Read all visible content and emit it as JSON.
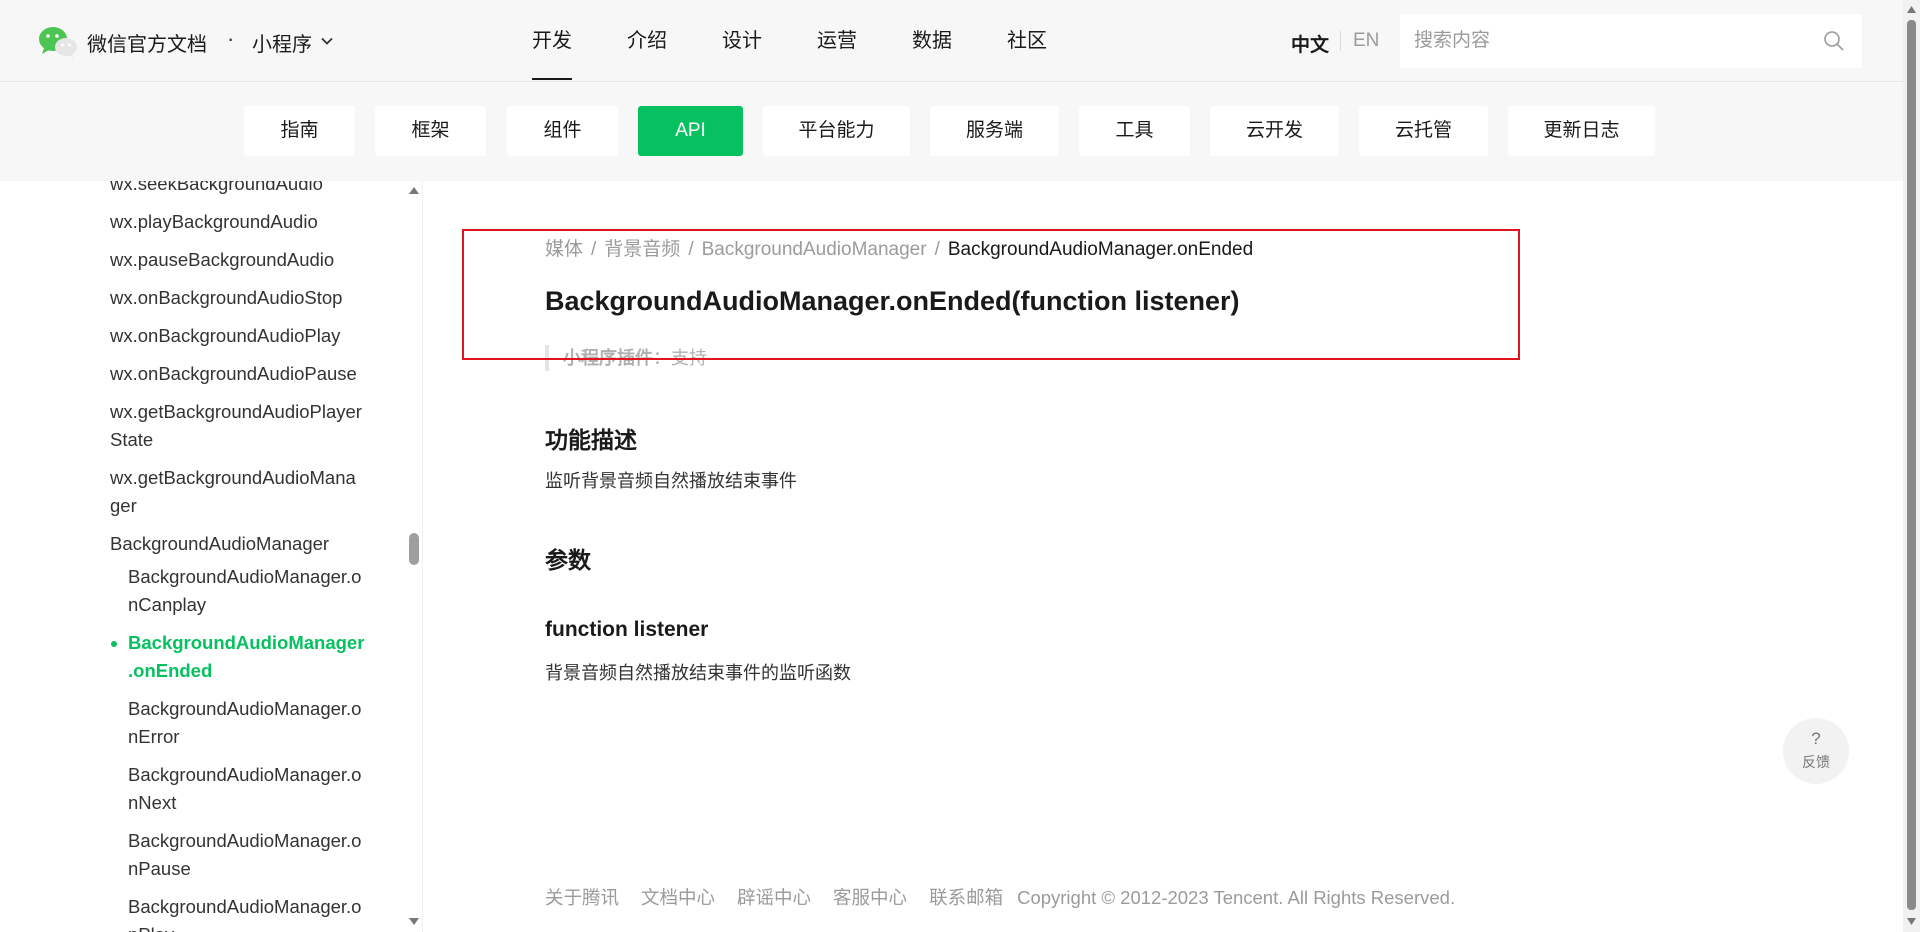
{
  "header": {
    "brand": "微信官方文档",
    "brand_dot": "·",
    "product": "小程序",
    "nav": [
      "开发",
      "介绍",
      "设计",
      "运营",
      "数据",
      "社区"
    ],
    "nav_active": "开发",
    "lang_zh": "中文",
    "lang_en": "EN",
    "search_placeholder": "搜索内容"
  },
  "subnav": {
    "tabs": [
      "指南",
      "框架",
      "组件",
      "API",
      "平台能力",
      "服务端",
      "工具",
      "云开发",
      "云托管",
      "更新日志"
    ],
    "active": "API"
  },
  "sidebar": {
    "items": [
      "wx.seekBackgroundAudio",
      "wx.playBackgroundAudio",
      "wx.pauseBackgroundAudio",
      "wx.onBackgroundAudioStop",
      "wx.onBackgroundAudioPlay",
      "wx.onBackgroundAudioPause",
      "wx.getBackgroundAudioPlayer",
      "State",
      "wx.getBackgroundAudioMana",
      "ger",
      "BackgroundAudioManager",
      "BackgroundAudioManager.o",
      "nCanplay",
      "BackgroundAudioManager",
      ".onEnded",
      "BackgroundAudioManager.o",
      "nError",
      "BackgroundAudioManager.o",
      "nNext",
      "BackgroundAudioManager.o",
      "nPause",
      "BackgroundAudioManager.o",
      "nPlay"
    ],
    "scroll_position": 0.55
  },
  "content": {
    "breadcrumb": [
      "媒体",
      "背景音频",
      "BackgroundAudioManager",
      "BackgroundAudioManager.onEnded"
    ],
    "breadcrumb_sep": "/",
    "title": "BackgroundAudioManager.onEnded(function listener)",
    "meta_label": "小程序插件",
    "meta_value": "：支持",
    "section_desc_title": "功能描述",
    "section_desc_text": "监听背景音频自然播放结束事件",
    "section_params_title": "参数",
    "param_name": "function listener",
    "param_desc": "背景音频自然播放结束事件的监听函数"
  },
  "footer": {
    "links": [
      "关于腾讯",
      "文档中心",
      "辟谣中心",
      "客服中心",
      "联系邮箱"
    ],
    "copyright": "Copyright © 2012-2023 Tencent. All Rights Reserved."
  },
  "feedback": {
    "icon": "?",
    "label": "反馈"
  },
  "colors": {
    "accent": "#07c160",
    "highlight": "#e0141c"
  }
}
